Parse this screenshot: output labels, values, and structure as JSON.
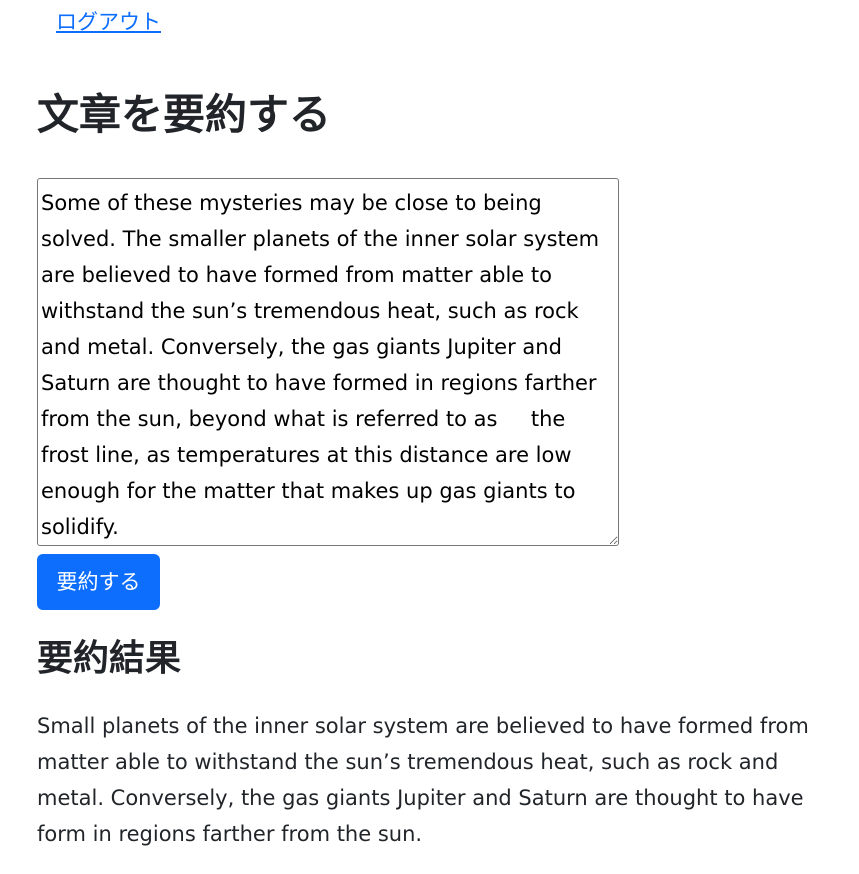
{
  "header": {
    "logout_label": "ログアウト"
  },
  "main": {
    "title": "文章を要約する",
    "input_text": "Some of these mysteries may be close to being solved. The smaller planets of the inner solar system are believed to have formed from matter able to withstand the sun’s tremendous heat, such as rock and metal. Conversely, the gas giants Jupiter and Saturn are thought to have formed in regions farther from the sun, beyond what is referred to as     the frost line, as temperatures at this distance are low enough for the matter that makes up gas giants to solidify.",
    "submit_label": "要約する",
    "result_heading": "要約結果",
    "result_text": "Small planets of the inner solar system are believed to have formed from matter able to withstand the sun’s tremendous heat, such as rock and metal. Conversely, the gas giants Jupiter and Saturn are thought to have form in regions farther from the sun."
  },
  "colors": {
    "link": "#0d6efd",
    "button_bg": "#0d6efd",
    "button_text": "#ffffff",
    "text": "#212529"
  }
}
